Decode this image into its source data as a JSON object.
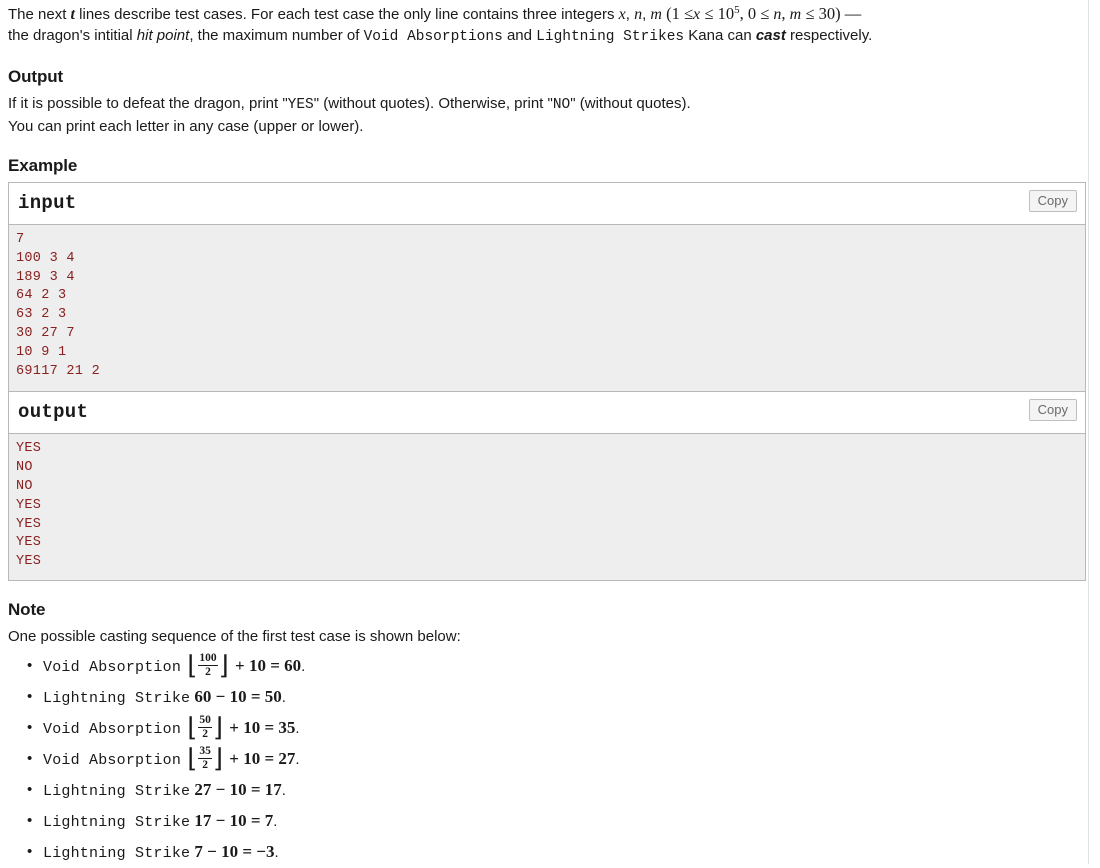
{
  "intro": {
    "line1_a": "The next ",
    "line1_t": "t",
    "line1_b": " lines describe test cases. For each test case the only line contains three integers ",
    "var_x": "x",
    "comma1": ", ",
    "var_n": "n",
    "comma2": ", ",
    "var_m": "m",
    "constraint_open": " (",
    "c1_a": "1 ",
    "c1_le": "≤",
    "c1_x": "x",
    "c1_le2": "≤",
    "c1_ten": "10",
    "c1_exp": "5",
    "c1_comma": ", ",
    "c2_zero": "0 ",
    "c2_le": "≤",
    "c2_n": "n",
    "c2_comma": ", ",
    "c2_m": "m",
    "c2_le2": "≤",
    "c2_thirty": "30",
    "constraint_close": ") ",
    "dash": "—",
    "line2_a": "the dragon's intitial ",
    "line2_italic": "hit point",
    "line2_b": ", the maximum number of ",
    "spell_void": "Void Absorptions",
    "line2_c": " and ",
    "spell_lightning": "Lightning Strikes",
    "line2_d": " Kana can ",
    "line2_cast": "cast",
    "line2_e": " respectively."
  },
  "output_section": {
    "heading": "Output",
    "line1_a": "If it is possible to defeat the dragon, print \"",
    "line1_yes": "YES",
    "line1_b": "\" (without quotes). Otherwise, print \"",
    "line1_no": "NO",
    "line1_c": "\" (without quotes).",
    "line2": "You can print each letter in any case (upper or lower)."
  },
  "example_section": {
    "heading": "Example",
    "input": {
      "title": "input",
      "copy_label": "Copy",
      "lines": [
        "7",
        "100 3 4",
        "189 3 4",
        "64 2 3",
        "63 2 3",
        "30 27 7",
        "10 9 1",
        "69117 21 2"
      ]
    },
    "output": {
      "title": "output",
      "copy_label": "Copy",
      "lines": [
        "YES",
        "NO",
        "NO",
        "YES",
        "YES",
        "YES",
        "YES"
      ]
    }
  },
  "note_section": {
    "heading": "Note",
    "intro": "One possible casting sequence of the first test case is shown below:",
    "items": [
      {
        "spell": "Void Absorption",
        "type": "floor",
        "numerator": "100",
        "denominator": "2",
        "op": "+",
        "operand": "10",
        "equals": "=",
        "result": "60",
        "period": "."
      },
      {
        "spell": "Lightning Strike",
        "type": "plain",
        "left": "60",
        "op": "−",
        "operand": "10",
        "equals": "=",
        "result": "50",
        "period": "."
      },
      {
        "spell": "Void Absorption",
        "type": "floor",
        "numerator": "50",
        "denominator": "2",
        "op": "+",
        "operand": "10",
        "equals": "=",
        "result": "35",
        "period": "."
      },
      {
        "spell": "Void Absorption",
        "type": "floor",
        "numerator": "35",
        "denominator": "2",
        "op": "+",
        "operand": "10",
        "equals": "=",
        "result": "27",
        "period": "."
      },
      {
        "spell": "Lightning Strike",
        "type": "plain",
        "left": "27",
        "op": "−",
        "operand": "10",
        "equals": "=",
        "result": "17",
        "period": "."
      },
      {
        "spell": "Lightning Strike",
        "type": "plain",
        "left": "17",
        "op": "−",
        "operand": "10",
        "equals": "=",
        "result": "7",
        "period": "."
      },
      {
        "spell": "Lightning Strike",
        "type": "plain",
        "left": "7",
        "op": "−",
        "operand": "10",
        "equals": "=",
        "result": "−3",
        "period": "."
      }
    ]
  },
  "colors": {
    "pre_text": "#8a2020",
    "pre_bg": "#eeeeee",
    "border": "#b8b8b8"
  }
}
